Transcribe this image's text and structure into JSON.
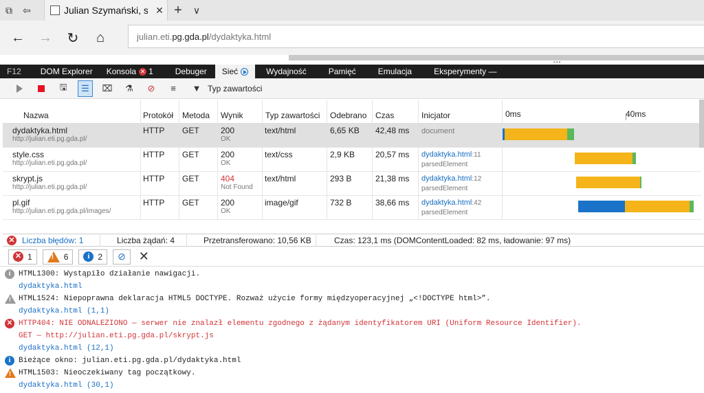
{
  "browser": {
    "tab_title": "Julian Szymański, strona",
    "address_domain": "julian.eti.",
    "address_host": "pg.gda.pl",
    "address_path": "/dydaktyka.html"
  },
  "devtools_menu": {
    "f12": "F12",
    "items": [
      "DOM Explorer",
      "Konsola",
      "Debuger",
      "Sieć",
      "Wydajność",
      "Pamięć",
      "Emulacja",
      "Eksperymenty —"
    ],
    "console_error_count": "1"
  },
  "toolbar": {
    "content_type_filter": "Typ zawartości"
  },
  "network": {
    "headers": [
      "Nazwa",
      "Protokół",
      "Metoda",
      "Wynik",
      "Typ zawartości",
      "Odebrano",
      "Czas",
      "Inicjator",
      "0ms",
      "40ms"
    ],
    "rows": [
      {
        "name": "dydaktyka.html",
        "url": "http://julian.eti.pg.gda.pl/",
        "protocol": "HTTP",
        "method": "GET",
        "status": "200",
        "status_text": "OK",
        "type": "text/html",
        "received": "6,65 KB",
        "time": "42,48 ms",
        "initiator": "document",
        "initiator_line": "",
        "initiator_sub": ""
      },
      {
        "name": "style.css",
        "url": "http://julian.eti.pg.gda.pl/",
        "protocol": "HTTP",
        "method": "GET",
        "status": "200",
        "status_text": "OK",
        "type": "text/css",
        "received": "2,9 KB",
        "time": "20,57 ms",
        "initiator": "dydaktyka.html",
        "initiator_line": ":11",
        "initiator_sub": "parsedElement"
      },
      {
        "name": "skrypt.js",
        "url": "http://julian.eti.pg.gda.pl/",
        "protocol": "HTTP",
        "method": "GET",
        "status": "404",
        "status_text": "Not Found",
        "type": "text/html",
        "received": "293 B",
        "time": "21,38 ms",
        "initiator": "dydaktyka.html",
        "initiator_line": ":12",
        "initiator_sub": "parsedElement"
      },
      {
        "name": "pl.gif",
        "url": "http://julian.eti.pg.gda.pl/images/",
        "protocol": "HTTP",
        "method": "GET",
        "status": "200",
        "status_text": "OK",
        "type": "image/gif",
        "received": "732 B",
        "time": "38,66 ms",
        "initiator": "dydaktyka.html",
        "initiator_line": ":42",
        "initiator_sub": "parsedElement"
      }
    ],
    "timeline_colors": {
      "wait": "#1a73c8",
      "receive": "#f4b41a",
      "done": "#5cb85c"
    }
  },
  "summary": {
    "errors": "Liczba błędów: 1",
    "requests": "Liczba żądań: 4",
    "transferred": "Przetransferowano: 10,56 KB",
    "time": "Czas: 123,1 ms (DOMContentLoaded: 82 ms, ładowanie: 97 ms)"
  },
  "console_filters": {
    "errors": "1",
    "warnings": "6",
    "info": "2"
  },
  "console": [
    {
      "icon": "info-gray",
      "line1": "HTML1300: Wystąpiło działanie nawigacji.",
      "line2": "dydaktyka.html",
      "line3": ""
    },
    {
      "icon": "warn-gray",
      "line1": "HTML1524: Niepoprawna deklaracja HTML5 DOCTYPE. Rozważ użycie formy międzyoperacyjnej „<!DOCTYPE html>”.",
      "line2": "dydaktyka.html (1,1)",
      "line3": ""
    },
    {
      "icon": "error",
      "line1": "HTTP404: NIE ODNALEZIONO — serwer nie znalazł elementu zgodnego z żądanym identyfikatorem URI (Uniform Resource Identifier).",
      "line2": "GET — http://julian.eti.pg.gda.pl/skrypt.js",
      "line3": "dydaktyka.html (12,1)"
    },
    {
      "icon": "info-blue",
      "line1": "Bieżące okno: julian.eti.pg.gda.pl/dydaktyka.html",
      "line2": "",
      "line3": ""
    },
    {
      "icon": "warn-orange",
      "line1": "HTML1503: Nieoczekiwany tag początkowy.",
      "line2": "dydaktyka.html (30,1)",
      "line3": ""
    }
  ]
}
